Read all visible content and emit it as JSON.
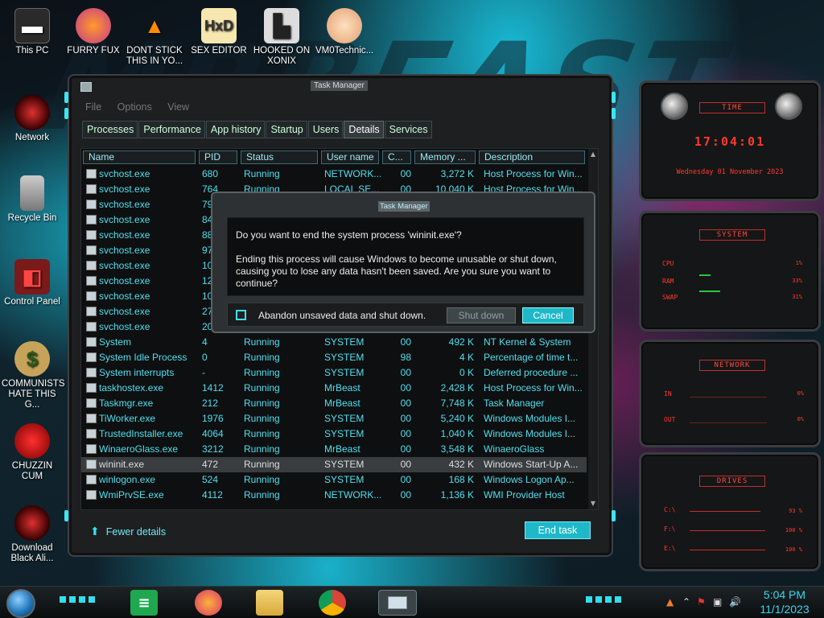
{
  "desktop_icons": [
    {
      "label": "This PC"
    },
    {
      "label": "FURRY FUX"
    },
    {
      "label": "DONT STICK THIS IN YO..."
    },
    {
      "label": "SEX EDITOR"
    },
    {
      "label": "HOOKED ON XONIX"
    },
    {
      "label": "VM0Technic..."
    },
    {
      "label": "Network"
    },
    {
      "label": "Recycle Bin"
    },
    {
      "label": "Control Panel"
    },
    {
      "label": "COMMUNISTS HATE THIS G..."
    },
    {
      "label": "CHUZZIN CUM"
    },
    {
      "label": "Download Black Ali..."
    }
  ],
  "task_manager": {
    "title": "Task Manager",
    "menu": [
      "File",
      "Options",
      "View"
    ],
    "tabs": [
      "Processes",
      "Performance",
      "App history",
      "Startup",
      "Users",
      "Details",
      "Services"
    ],
    "active_tab": "Details",
    "columns": [
      "Name",
      "PID",
      "Status",
      "User name",
      "C...",
      "Memory ...",
      "Description"
    ],
    "rows": [
      {
        "name": "svchost.exe",
        "pid": "680",
        "status": "Running",
        "user": "NETWORK...",
        "cpu": "00",
        "mem": "3,272 K",
        "desc": "Host Process for Win..."
      },
      {
        "name": "svchost.exe",
        "pid": "764",
        "status": "Running",
        "user": "LOCAL SE...",
        "cpu": "00",
        "mem": "10,040 K",
        "desc": "Host Process for Win..."
      },
      {
        "name": "svchost.exe",
        "pid": "79",
        "status": "",
        "user": "",
        "cpu": "",
        "mem": "",
        "desc": ""
      },
      {
        "name": "svchost.exe",
        "pid": "84",
        "status": "",
        "user": "",
        "cpu": "",
        "mem": "",
        "desc": ""
      },
      {
        "name": "svchost.exe",
        "pid": "88",
        "status": "",
        "user": "",
        "cpu": "",
        "mem": "",
        "desc": ""
      },
      {
        "name": "svchost.exe",
        "pid": "97",
        "status": "",
        "user": "",
        "cpu": "",
        "mem": "",
        "desc": ""
      },
      {
        "name": "svchost.exe",
        "pid": "105",
        "status": "",
        "user": "",
        "cpu": "",
        "mem": "",
        "desc": ""
      },
      {
        "name": "svchost.exe",
        "pid": "12",
        "status": "",
        "user": "",
        "cpu": "",
        "mem": "",
        "desc": ""
      },
      {
        "name": "svchost.exe",
        "pid": "10",
        "status": "",
        "user": "",
        "cpu": "",
        "mem": "",
        "desc": ""
      },
      {
        "name": "svchost.exe",
        "pid": "27",
        "status": "",
        "user": "",
        "cpu": "",
        "mem": "",
        "desc": ""
      },
      {
        "name": "svchost.exe",
        "pid": "20",
        "status": "",
        "user": "",
        "cpu": "",
        "mem": "",
        "desc": ""
      },
      {
        "name": "System",
        "pid": "4",
        "status": "Running",
        "user": "SYSTEM",
        "cpu": "00",
        "mem": "492 K",
        "desc": "NT Kernel & System"
      },
      {
        "name": "System Idle Process",
        "pid": "0",
        "status": "Running",
        "user": "SYSTEM",
        "cpu": "98",
        "mem": "4 K",
        "desc": "Percentage of time t..."
      },
      {
        "name": "System interrupts",
        "pid": "-",
        "status": "Running",
        "user": "SYSTEM",
        "cpu": "00",
        "mem": "0 K",
        "desc": "Deferred procedure ..."
      },
      {
        "name": "taskhostex.exe",
        "pid": "1412",
        "status": "Running",
        "user": "MrBeast",
        "cpu": "00",
        "mem": "2,428 K",
        "desc": "Host Process for Win..."
      },
      {
        "name": "Taskmgr.exe",
        "pid": "212",
        "status": "Running",
        "user": "MrBeast",
        "cpu": "00",
        "mem": "7,748 K",
        "desc": "Task Manager"
      },
      {
        "name": "TiWorker.exe",
        "pid": "1976",
        "status": "Running",
        "user": "SYSTEM",
        "cpu": "00",
        "mem": "5,240 K",
        "desc": "Windows Modules I..."
      },
      {
        "name": "TrustedInstaller.exe",
        "pid": "4064",
        "status": "Running",
        "user": "SYSTEM",
        "cpu": "00",
        "mem": "1,040 K",
        "desc": "Windows Modules I..."
      },
      {
        "name": "WinaeroGlass.exe",
        "pid": "3212",
        "status": "Running",
        "user": "MrBeast",
        "cpu": "00",
        "mem": "3,548 K",
        "desc": "WinaeroGlass"
      },
      {
        "name": "wininit.exe",
        "pid": "472",
        "status": "Running",
        "user": "SYSTEM",
        "cpu": "00",
        "mem": "432 K",
        "desc": "Windows Start-Up A...",
        "selected": true
      },
      {
        "name": "winlogon.exe",
        "pid": "524",
        "status": "Running",
        "user": "SYSTEM",
        "cpu": "00",
        "mem": "168 K",
        "desc": "Windows Logon Ap..."
      },
      {
        "name": "WmiPrvSE.exe",
        "pid": "4112",
        "status": "Running",
        "user": "NETWORK...",
        "cpu": "00",
        "mem": "1,136 K",
        "desc": "WMI Provider Host"
      }
    ],
    "fewer_details": "Fewer details",
    "end_task": "End task"
  },
  "dialog": {
    "title": "Task Manager",
    "question": "Do you want to end the system process 'wininit.exe'?",
    "message": "Ending this process will cause Windows to become unusable or shut down, causing you to lose any data hasn't been saved. Are you sure you want to continue?",
    "checkbox_label": "Abandon unsaved data and shut down.",
    "checkbox_checked": false,
    "shutdown_button": "Shut down",
    "cancel_button": "Cancel"
  },
  "gadgets": {
    "time": {
      "title": "TIME",
      "clock": "17:04:01",
      "date": "Wednesday 01 November 2023"
    },
    "system": {
      "title": "SYSTEM",
      "cpu_label": "CPU",
      "cpu_value": "1%",
      "ram_label": "RAM",
      "ram_value": "33%",
      "swap_label": "SWAP",
      "swap_value": "31%"
    },
    "network": {
      "title": "NETWORK",
      "in_label": "IN",
      "in_value": "0%",
      "out_label": "OUT",
      "out_value": "0%"
    },
    "drives": {
      "title": "DRIVES",
      "drives": [
        {
          "label": "C:\\",
          "value": "93 %"
        },
        {
          "label": "F:\\",
          "value": "100 %"
        },
        {
          "label": "E:\\",
          "value": "100 %"
        }
      ]
    }
  },
  "taskbar": {
    "time": "5:04 PM",
    "date": "11/1/2023",
    "apps": [
      "notes-icon",
      "firefox-icon",
      "file-explorer-icon",
      "chrome-icon",
      "task-manager-icon"
    ]
  },
  "colors": {
    "accent": "#1fb8c8",
    "gadget_red": "#ff3a2c",
    "grid_text": "#4fe0f0"
  }
}
